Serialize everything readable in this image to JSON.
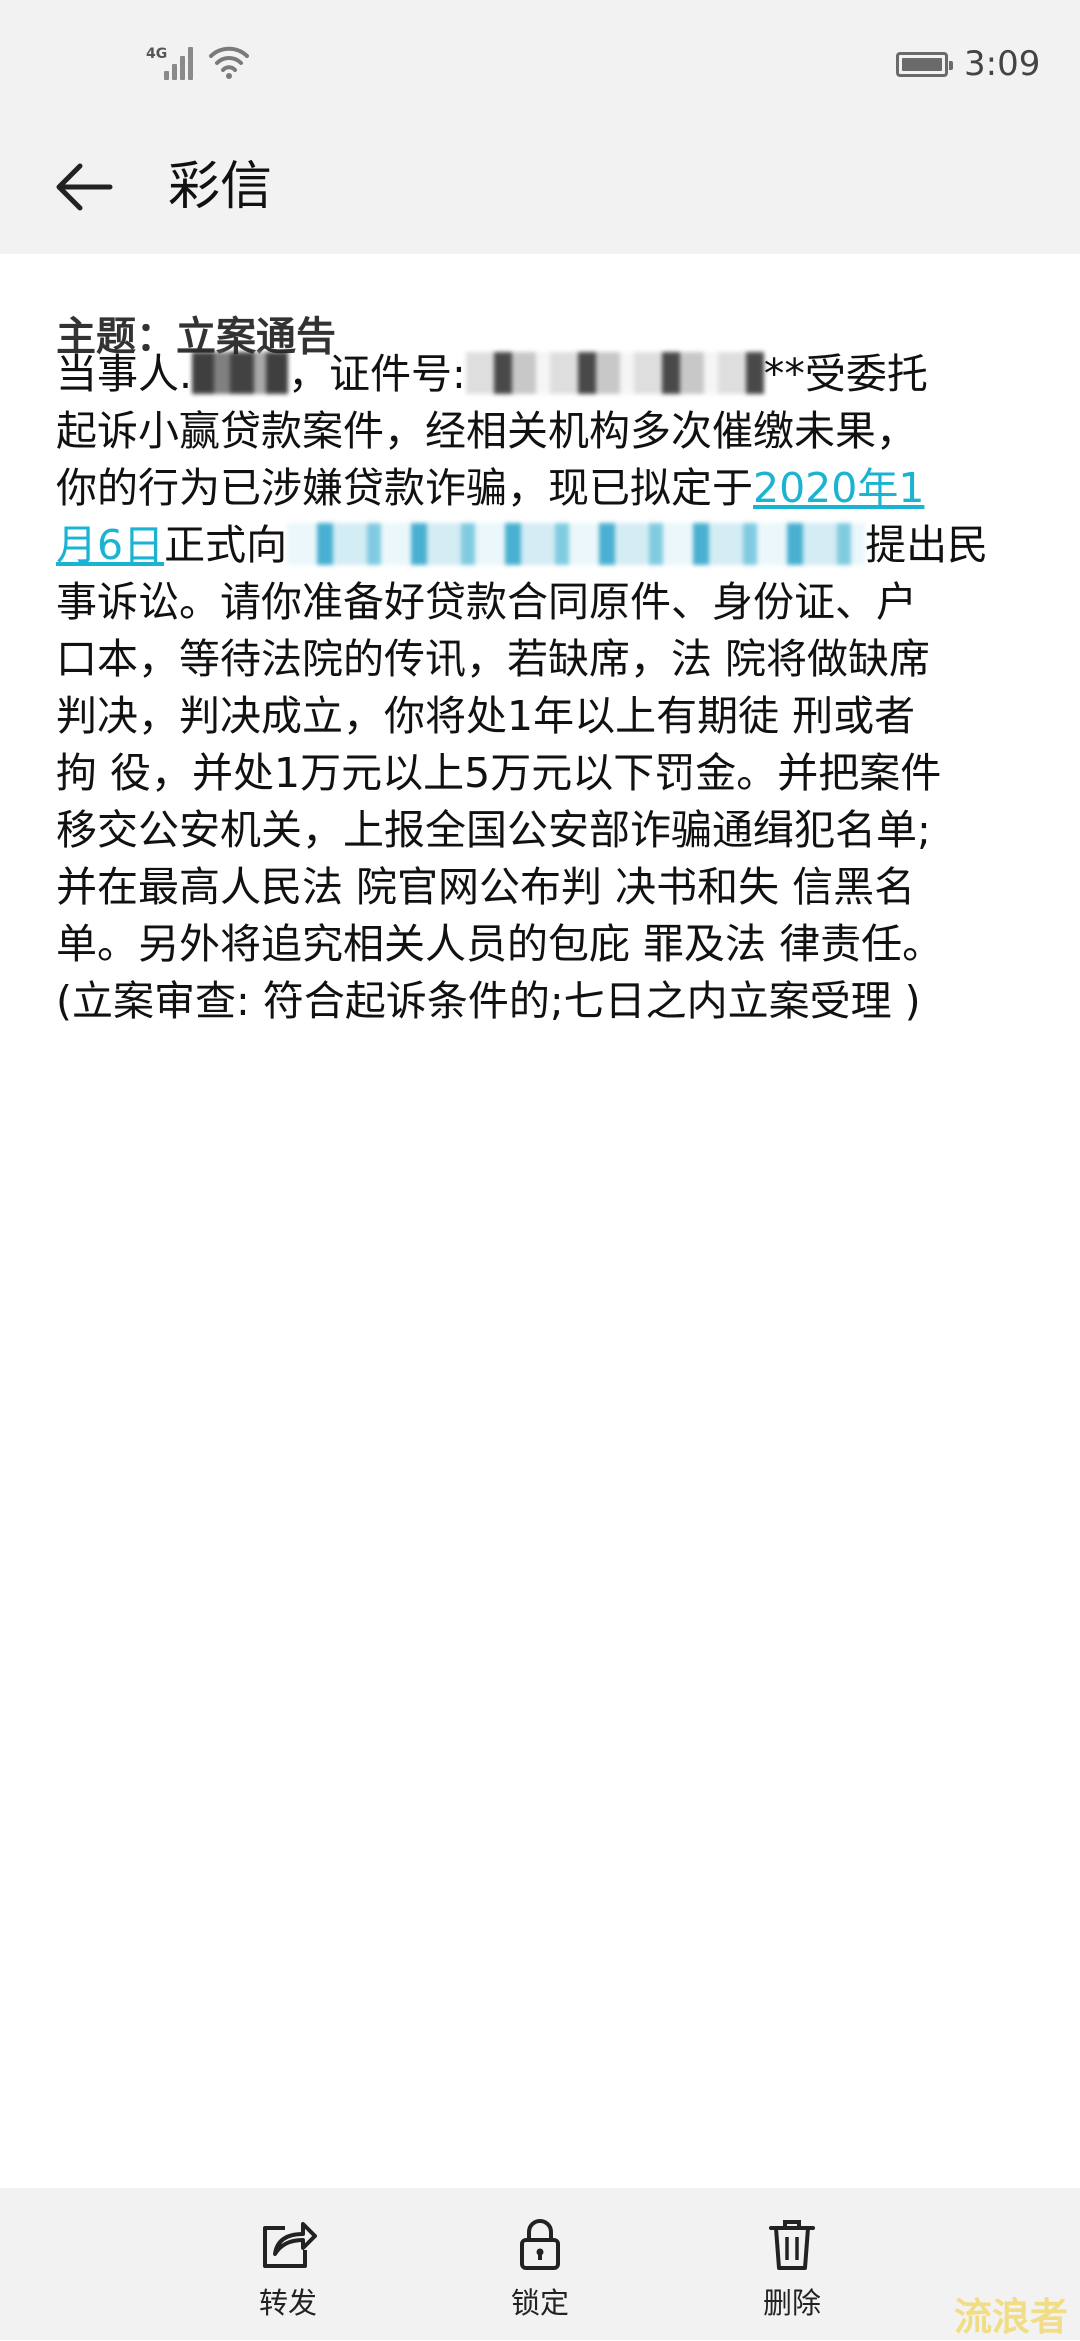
{
  "status_bar": {
    "network": "4G",
    "time": "3:09"
  },
  "header": {
    "title": "彩信"
  },
  "message": {
    "subject": "主题：立案通告",
    "lines": [
      {
        "a": "当事人.",
        "b": "，证件号:",
        "c": "**受委托"
      },
      "起诉小赢贷款案件，经相关机构多次催缴未果，",
      {
        "a": "你的行为已涉嫌贷款诈骗，现已拟定于",
        "link": "2020年1"
      },
      {
        "link": "月6日",
        "a": "正式向",
        "b": "提出民"
      },
      "事诉讼。请你准备好贷款合同原件、身份证、户",
      "口本，等待法院的传讯，若缺席，法 院将做缺席",
      "判决，判决成立，你将处1年以上有期徒 刑或者",
      "拘 役，并处1万元以上5万元以下罚金。并把案件",
      "移交公安机关，上报全国公安部诈骗通缉犯名单;",
      "并在最高人民法 院官网公布判 决书和失 信黑名",
      "单。另外将追究相关人员的包庇 罪及法 律责任。",
      "(立案审查: 符合起诉条件的;七日之内立案受理 )"
    ]
  },
  "actions": {
    "forward": "转发",
    "lock": "锁定",
    "delete": "删除"
  },
  "watermark": "流浪者",
  "colors": {
    "link": "#1ab3d1",
    "bar_bg": "#f2f2f2"
  },
  "icons": [
    "signal-icon",
    "wifi-icon",
    "battery-icon",
    "back-arrow-icon",
    "share-icon",
    "lock-icon",
    "trash-icon"
  ]
}
